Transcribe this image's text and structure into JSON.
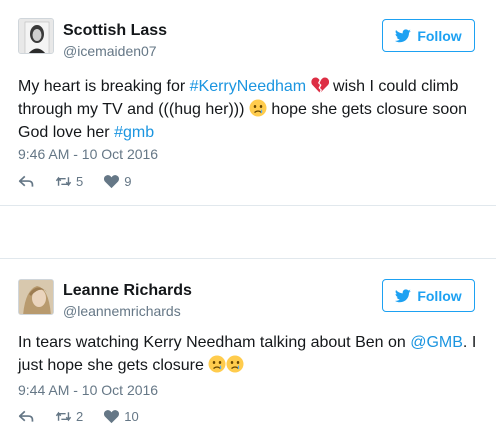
{
  "tweets": [
    {
      "name": "Scottish Lass",
      "handle": "@icemaiden07",
      "follow_label": "Follow",
      "text": {
        "p1": "My heart is breaking for ",
        "tag1": "#KerryNeedham",
        "p2": " wish I could climb through my TV and (((hug her))) ",
        "p3": " hope she gets closure soon God love her ",
        "tag2": "#gmb"
      },
      "timestamp": "9:46 AM - 10 Oct 2016",
      "retweets": "5",
      "likes": "9"
    },
    {
      "name": "Leanne Richards",
      "handle": "@leannemrichards",
      "follow_label": "Follow",
      "text": {
        "p1": "In tears watching Kerry Needham talking about Ben on ",
        "mention": "@GMB",
        "p2": ". I just hope she gets closure "
      },
      "timestamp": "9:44 AM - 10 Oct 2016",
      "retweets": "2",
      "likes": "10"
    }
  ],
  "colors": {
    "accent": "#1da1f2",
    "link": "#1b95e0",
    "muted": "#657786",
    "text": "#14171a"
  },
  "icons": [
    "twitter-bird-icon",
    "reply-icon",
    "retweet-icon",
    "heart-icon",
    "broken-heart-emoji-icon",
    "crying-face-emoji-icon"
  ]
}
